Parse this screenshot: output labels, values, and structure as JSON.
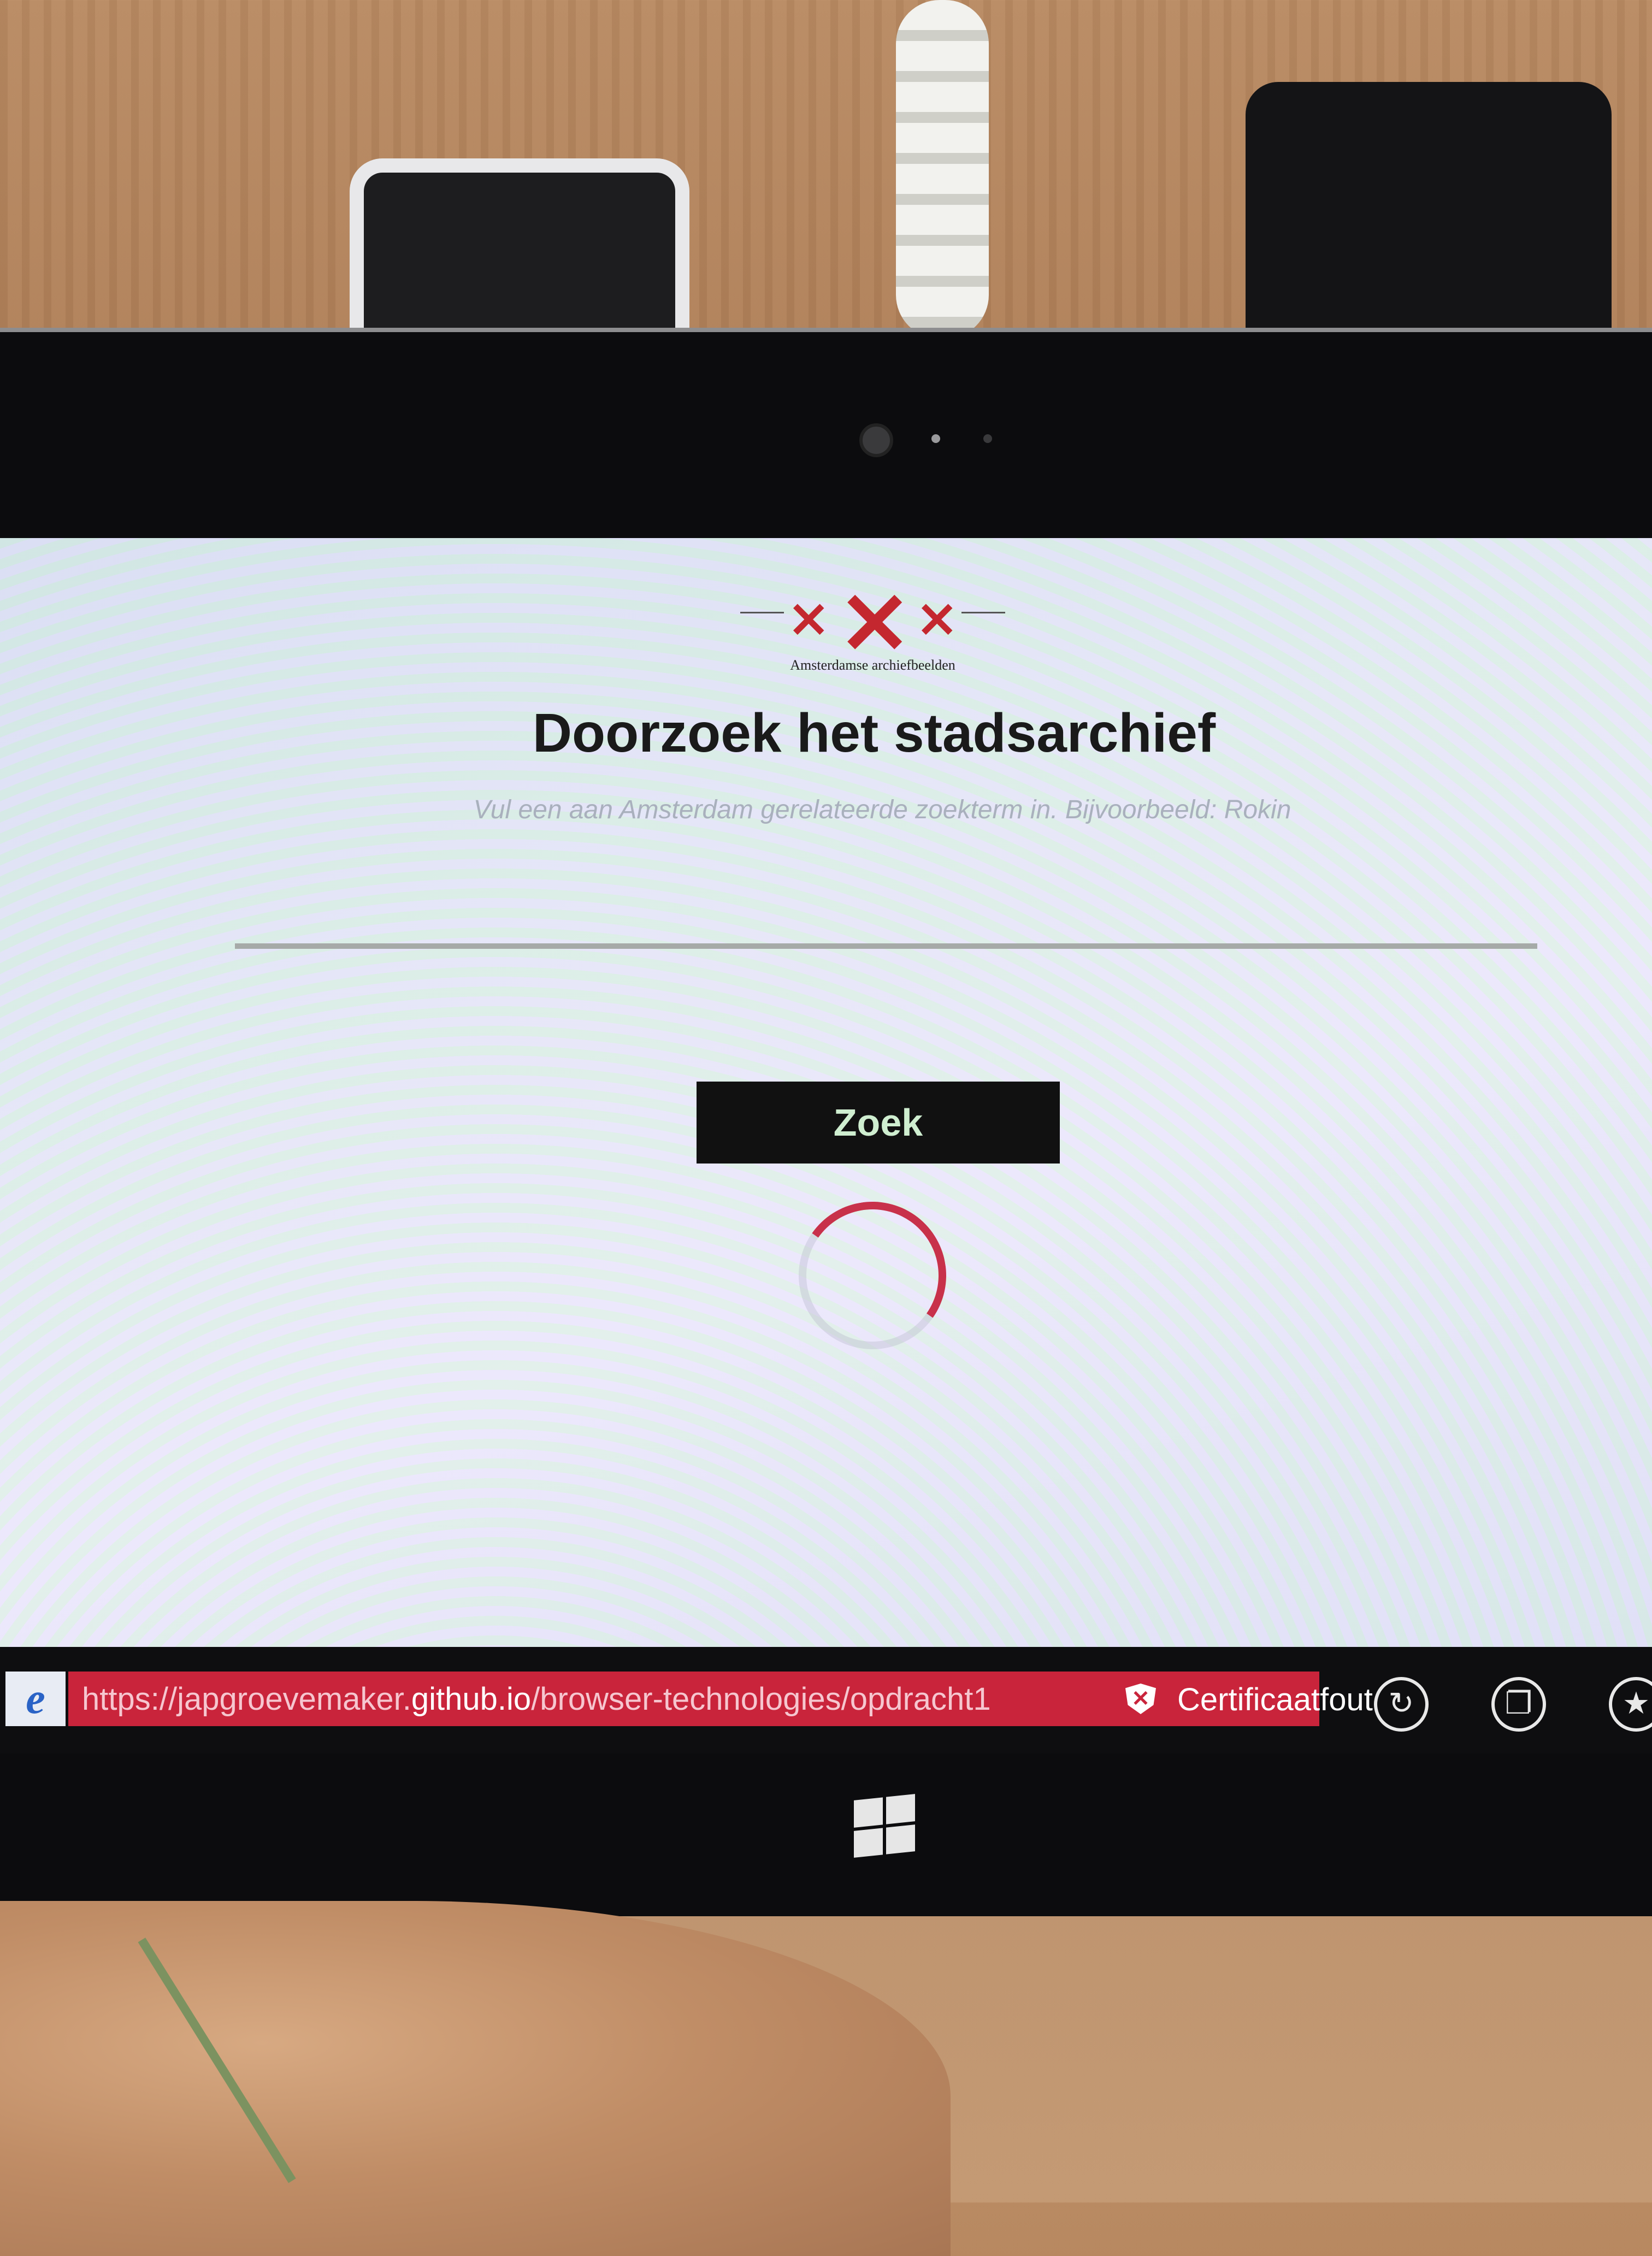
{
  "logo": {
    "marks": [
      "×",
      "×",
      "×"
    ],
    "caption": "Amsterdamse archiefbeelden"
  },
  "page": {
    "title": "Doorzoek het stadsarchief",
    "hint": "Vul een aan Amsterdam gerelateerde zoekterm in. Bijvoorbeeld: Rokin",
    "search_value": "",
    "button_label": "Zoek"
  },
  "browser": {
    "url_prefix": "https://japgroevemaker.",
    "url_domain": "github.io",
    "url_path": "/browser-technologies/opdracht1",
    "cert_status": "Certificaatfout",
    "colors": {
      "error_bar": "#c9243b",
      "accent": "#c4272f"
    },
    "icons": [
      "ie-icon",
      "shield-icon",
      "refresh-icon",
      "tabs-icon",
      "favorites-icon",
      "windows-icon"
    ]
  }
}
